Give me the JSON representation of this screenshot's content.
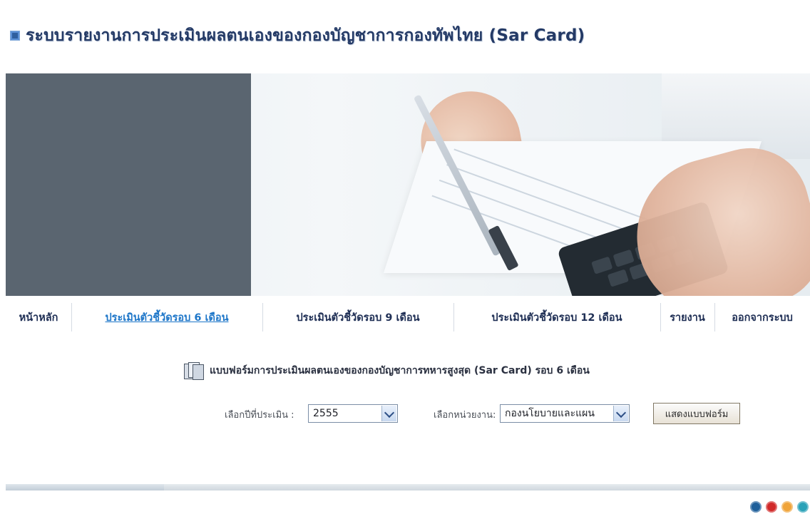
{
  "header": {
    "title": "ระบบรายงานการประเมินผลตนเองของกองบัญชาการกองทัพไทย (Sar Card)"
  },
  "nav": {
    "items": [
      {
        "label": "หน้าหลัก"
      },
      {
        "label": "ประเมินตัวชี้วัดรอบ 6 เดือน"
      },
      {
        "label": "ประเมินตัวชี้วัดรอบ 9 เดือน"
      },
      {
        "label": "ประเมินตัวชี้วัดรอบ 12 เดือน"
      },
      {
        "label": "รายงาน"
      },
      {
        "label": "ออกจากระบบ"
      }
    ],
    "active_index": 1
  },
  "form": {
    "title": "แบบฟอร์มการประเมินผลตนเองของกองบัญชาการทหารสูงสุด (Sar Card) รอบ 6 เดือน",
    "year_label": "เลือกปีที่ประเมิน :",
    "year_value": "2555",
    "unit_label": "เลือกหน่วยงาน:",
    "unit_value": "กองนโยบายและแผน",
    "show_button_label": "แสดงแบบฟอร์ม"
  },
  "footer": {
    "dots": [
      {
        "color": "#1f5f9a"
      },
      {
        "color": "#d12a2a"
      },
      {
        "color": "#f0a43a"
      },
      {
        "color": "#2aa2b8"
      }
    ]
  },
  "icons": {
    "title_bullet": "square-bullet-icon",
    "form_icon": "stack-of-pages-icon",
    "dropdown": "chevron-down-icon",
    "dots": "status-dot-icon"
  }
}
